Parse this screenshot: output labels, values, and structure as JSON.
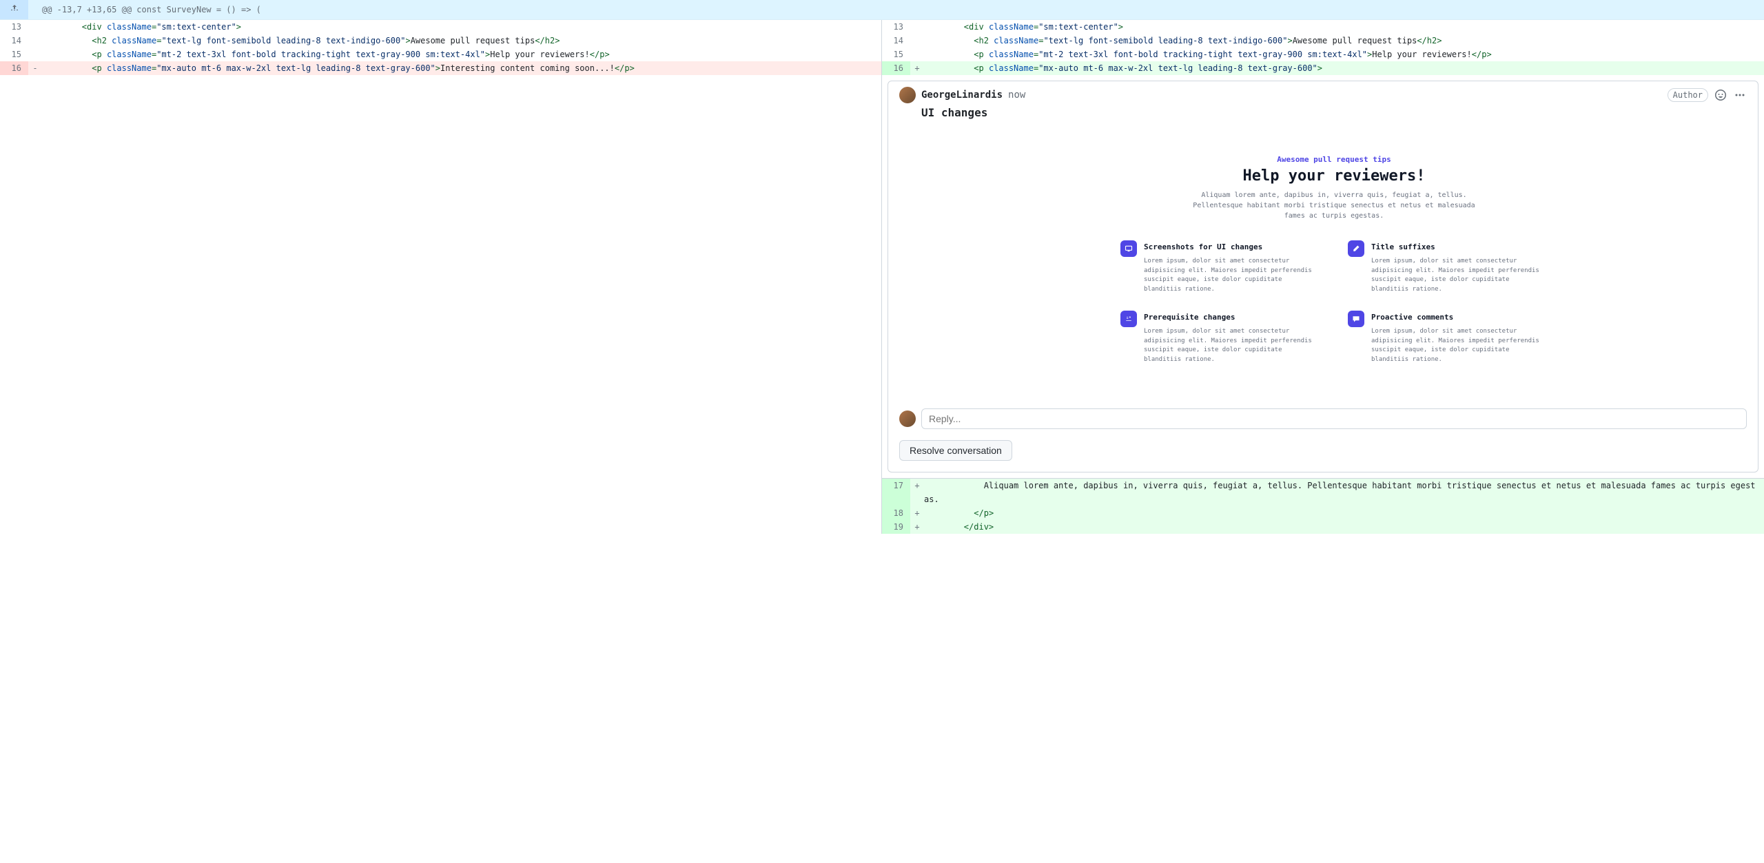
{
  "hunk": "@@ -13,7 +13,65 @@ const SurveyNew = () => (",
  "left": {
    "lines": [
      {
        "n": "13",
        "t": "ctx",
        "m": " ",
        "code": "        <div className=\"sm:text-center\">"
      },
      {
        "n": "14",
        "t": "ctx",
        "m": " ",
        "code": "          <h2 className=\"text-lg font-semibold leading-8 text-indigo-600\">Awesome pull request tips</h2>"
      },
      {
        "n": "15",
        "t": "ctx",
        "m": " ",
        "code": "          <p className=\"mt-2 text-3xl font-bold tracking-tight text-gray-900 sm:text-4xl\">Help your reviewers!</p>"
      },
      {
        "n": "16",
        "t": "del",
        "m": "-",
        "code": "          <p className=\"mx-auto mt-6 max-w-2xl text-lg leading-8 text-gray-600\">Interesting content coming soon...!</p>"
      }
    ]
  },
  "right": {
    "lines": [
      {
        "n": "13",
        "t": "ctx",
        "m": " ",
        "code": "        <div className=\"sm:text-center\">"
      },
      {
        "n": "14",
        "t": "ctx",
        "m": " ",
        "code": "          <h2 className=\"text-lg font-semibold leading-8 text-indigo-600\">Awesome pull request tips</h2>"
      },
      {
        "n": "15",
        "t": "ctx",
        "m": " ",
        "code": "          <p className=\"mt-2 text-3xl font-bold tracking-tight text-gray-900 sm:text-4xl\">Help your reviewers!</p>"
      },
      {
        "n": "16",
        "t": "add",
        "m": "+",
        "code": "          <p className=\"mx-auto mt-6 max-w-2xl text-lg leading-8 text-gray-600\">"
      }
    ]
  },
  "below": [
    {
      "n": "17",
      "t": "add",
      "m": "+",
      "code": "            Aliquam lorem ante, dapibus in, viverra quis, feugiat a, tellus. Pellentesque habitant morbi tristique senectus et netus et malesuada fames ac turpis egestas."
    },
    {
      "n": "18",
      "t": "add",
      "m": "+",
      "code": "          </p>"
    },
    {
      "n": "19",
      "t": "add",
      "m": "+",
      "code": "        </div>"
    }
  ],
  "comment": {
    "author": "GeorgeLinardis",
    "time": "now",
    "author_badge": "Author",
    "title": "UI changes",
    "reply_placeholder": "Reply...",
    "resolve_label": "Resolve conversation"
  },
  "preview": {
    "kicker": "Awesome pull request tips",
    "headline": "Help your reviewers!",
    "sub": "Aliquam lorem ante, dapibus in, viverra quis, feugiat a, tellus. Pellentesque habitant morbi tristique senectus et netus et malesuada fames ac turpis egestas.",
    "features": [
      {
        "title": "Screenshots for UI changes",
        "desc": "Lorem ipsum, dolor sit amet consectetur adipisicing elit. Maiores impedit perferendis suscipit eaque, iste dolor cupiditate blanditiis ratione.",
        "icon": "monitor"
      },
      {
        "title": "Title suffixes",
        "desc": "Lorem ipsum, dolor sit amet consectetur adipisicing elit. Maiores impedit perferendis suscipit eaque, iste dolor cupiditate blanditiis ratione.",
        "icon": "pencil"
      },
      {
        "title": "Prerequisite changes",
        "desc": "Lorem ipsum, dolor sit amet consectetur adipisicing elit. Maiores impedit perferendis suscipit eaque, iste dolor cupiditate blanditiis ratione.",
        "icon": "plusminus"
      },
      {
        "title": "Proactive comments",
        "desc": "Lorem ipsum, dolor sit amet consectetur adipisicing elit. Maiores impedit perferendis suscipit eaque, iste dolor cupiditate blanditiis ratione.",
        "icon": "chat"
      }
    ]
  }
}
